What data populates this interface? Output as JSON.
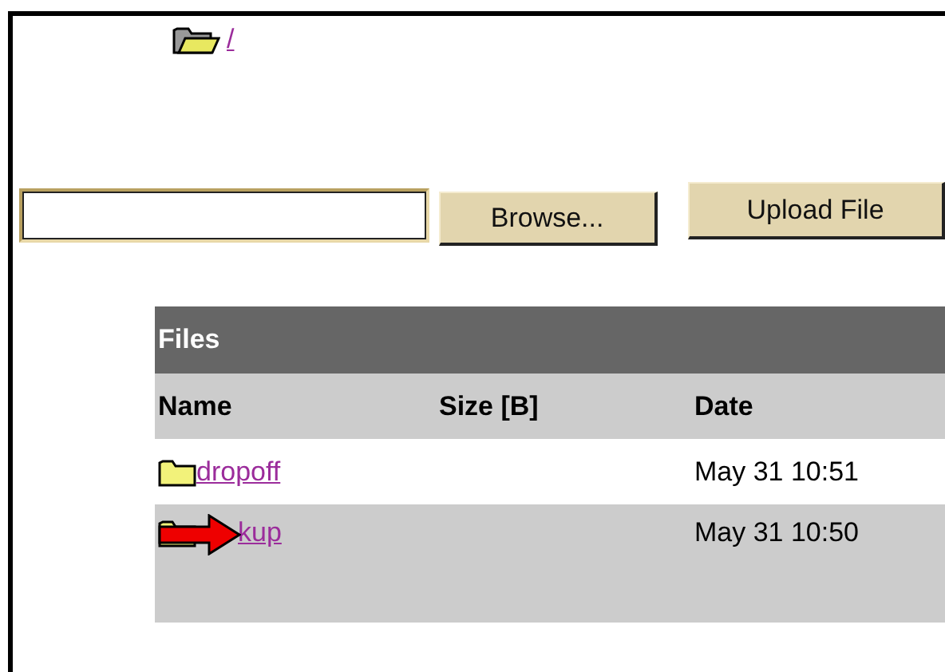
{
  "breadcrumb": {
    "link": "/"
  },
  "upload": {
    "browse_button": "Browse...",
    "upload_button": "Upload File"
  },
  "table": {
    "title": "Files",
    "columns": [
      "Name",
      "Size [B]",
      "Date"
    ],
    "rows": [
      {
        "name": "dropoff",
        "size": "",
        "date": "May 31 10:51",
        "arrow": false
      },
      {
        "name": "kup",
        "size": "",
        "date": "May 31 10:50",
        "arrow": true
      }
    ]
  }
}
